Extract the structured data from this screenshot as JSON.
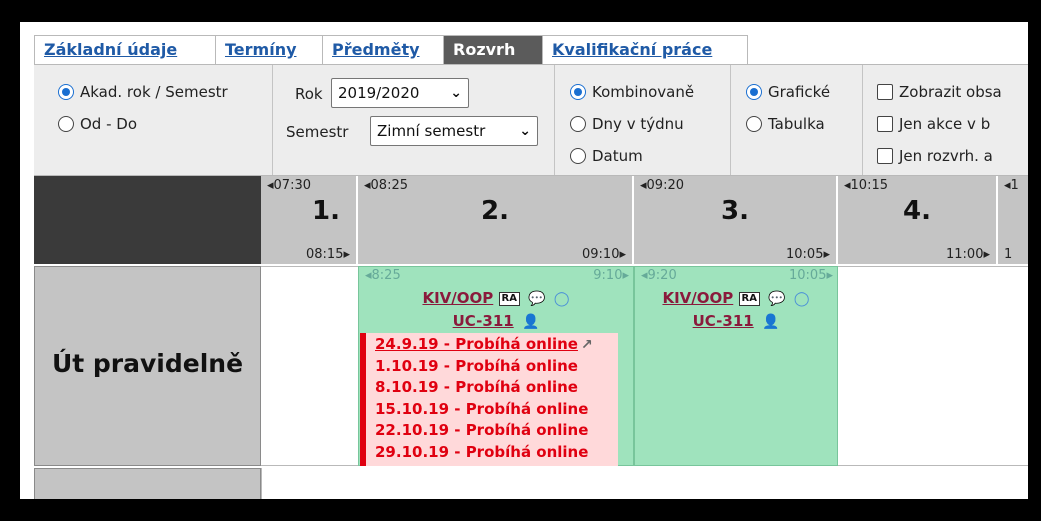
{
  "tabs": [
    {
      "label": "Základní údaje"
    },
    {
      "label": "Termíny"
    },
    {
      "label": "Předměty"
    },
    {
      "label": "Rozvrh"
    },
    {
      "label": "Kvalifikační práce"
    }
  ],
  "options": {
    "period_mode": {
      "opt1": "Akad. rok / Semestr",
      "opt2": "Od - Do",
      "selected": "Akad. rok / Semestr"
    },
    "year_label": "Rok",
    "year_value": "2019/2020",
    "semester_label": "Semestr",
    "semester_value": "Zimní semestr",
    "view_mode": {
      "opt1": "Kombinovaně",
      "opt2": "Dny v týdnu",
      "opt3": "Datum",
      "selected": "Kombinovaně"
    },
    "display_mode": {
      "opt1": "Grafické",
      "opt2": "Tabulka",
      "selected": "Grafické"
    },
    "checkboxes": [
      "Zobrazit obsa",
      "Jen akce v b",
      "Jen rozvrh. a"
    ]
  },
  "slots": [
    {
      "start": "07:30",
      "num": "1.",
      "end": "08:15"
    },
    {
      "start": "08:25",
      "num": "2.",
      "end": "09:10"
    },
    {
      "start": "09:20",
      "num": "3.",
      "end": "10:05"
    },
    {
      "start": "10:15",
      "num": "4.",
      "end": "11:00"
    },
    {
      "start": "1",
      "num": "",
      "end": "1"
    }
  ],
  "row": {
    "label": "Út pravidelně"
  },
  "events": [
    {
      "start": "8:25",
      "end": "9:10",
      "course": "KIV/OOP",
      "badge": "RA",
      "room": "UC-311",
      "notes": [
        "24.9.19 - Probíhá online",
        "1.10.19 - Probíhá online",
        "8.10.19 - Probíhá online",
        "15.10.19 - Probíhá online",
        "22.10.19 - Probíhá online",
        "29.10.19 - Probíhá online"
      ]
    },
    {
      "start": "9:20",
      "end": "10:05",
      "course": "KIV/OOP",
      "badge": "RA",
      "room": "UC-311"
    }
  ],
  "icons": {
    "arrow_left": "left-triangle-icon",
    "arrow_right": "right-triangle-icon",
    "note": "speech-bubble-icon",
    "chat": "chat-icon",
    "teacher": "teacher-icon",
    "external": "external-link-icon"
  }
}
